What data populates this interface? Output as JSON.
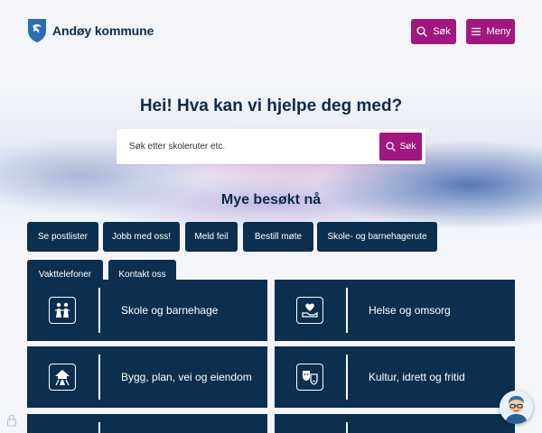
{
  "header": {
    "logo_text": "Andøy kommune",
    "search_button_label": "Søk",
    "menu_button_label": "Meny"
  },
  "hero": {
    "title": "Hei! Hva kan vi hjelpe deg med?",
    "search_placeholder": "Søk etter skoleruter etc.",
    "search_button_label": "Søk"
  },
  "popular": {
    "title": "Mye besøkt nå",
    "links": [
      "Se postlister",
      "Jobb med oss!",
      "Meld feil",
      "Bestill møte",
      "Skole- og barnehagerute",
      "Vakttelefoner",
      "Kontakt oss"
    ]
  },
  "categories": [
    {
      "label": "Skole og barnehage",
      "icon": "school-children-icon"
    },
    {
      "label": "Helse og omsorg",
      "icon": "health-care-icon"
    },
    {
      "label": "Bygg, plan, vei og eiendom",
      "icon": "building-road-icon"
    },
    {
      "label": "Kultur, idrett og fritid",
      "icon": "culture-masks-icon"
    }
  ],
  "colors": {
    "accent": "#a1177f",
    "navy": "#0c2f4f",
    "text": "#0f2a4a",
    "background": "#f3f5fa"
  }
}
